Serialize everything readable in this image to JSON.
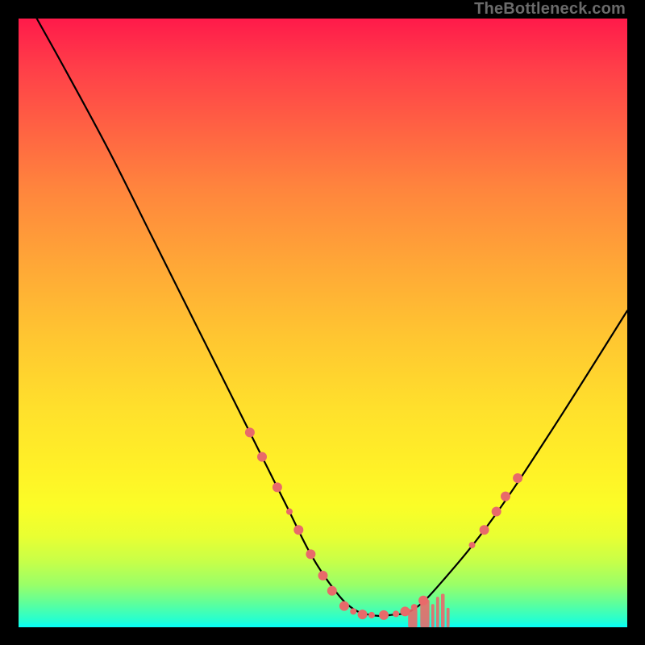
{
  "watermark": "TheBottleneck.com",
  "chart_data": {
    "type": "line",
    "title": "",
    "xlabel": "",
    "ylabel": "",
    "xlim": [
      0,
      100
    ],
    "ylim": [
      0,
      100
    ],
    "grid": false,
    "series": [
      {
        "name": "bottleneck-curve",
        "x": [
          3,
          8,
          15,
          22,
          30,
          38,
          44,
          48,
          52,
          55,
          58,
          61,
          65,
          70,
          78,
          88,
          100
        ],
        "y": [
          100,
          91,
          78,
          64,
          48,
          32,
          20,
          12,
          6,
          3,
          2,
          2,
          3,
          8,
          18,
          33,
          52
        ],
        "color": "#000000"
      }
    ],
    "markers": {
      "name": "highlight-points",
      "color": "#e86a6a",
      "radius_large": 6.0,
      "radius_small": 4.0,
      "points": [
        {
          "x": 38.0,
          "y": 32.0,
          "r": "large"
        },
        {
          "x": 40.0,
          "y": 28.0,
          "r": "large"
        },
        {
          "x": 42.5,
          "y": 23.0,
          "r": "large"
        },
        {
          "x": 44.5,
          "y": 19.0,
          "r": "small"
        },
        {
          "x": 46.0,
          "y": 16.0,
          "r": "large"
        },
        {
          "x": 48.0,
          "y": 12.0,
          "r": "large"
        },
        {
          "x": 50.0,
          "y": 8.5,
          "r": "large"
        },
        {
          "x": 51.5,
          "y": 6.0,
          "r": "large"
        },
        {
          "x": 53.5,
          "y": 3.5,
          "r": "large"
        },
        {
          "x": 55.0,
          "y": 2.6,
          "r": "small"
        },
        {
          "x": 56.5,
          "y": 2.1,
          "r": "large"
        },
        {
          "x": 58.0,
          "y": 2.0,
          "r": "small"
        },
        {
          "x": 60.0,
          "y": 2.0,
          "r": "large"
        },
        {
          "x": 62.0,
          "y": 2.2,
          "r": "small"
        },
        {
          "x": 63.5,
          "y": 2.6,
          "r": "large"
        },
        {
          "x": 65.0,
          "y": 3.3,
          "r": "small"
        },
        {
          "x": 66.5,
          "y": 4.4,
          "r": "large"
        },
        {
          "x": 74.5,
          "y": 13.5,
          "r": "small"
        },
        {
          "x": 76.5,
          "y": 16.0,
          "r": "large"
        },
        {
          "x": 78.5,
          "y": 19.0,
          "r": "large"
        },
        {
          "x": 80.0,
          "y": 21.5,
          "r": "large"
        },
        {
          "x": 82.0,
          "y": 24.5,
          "r": "large"
        }
      ]
    },
    "bottom_streaks": {
      "color": "#e86a6a",
      "segments": [
        {
          "x0": 64.0,
          "x1": 65.5,
          "y0": 0.0,
          "y1": 3.0
        },
        {
          "x0": 66.0,
          "x1": 67.5,
          "y0": 0.0,
          "y1": 4.5
        },
        {
          "x0": 67.8,
          "x1": 68.3,
          "y0": 0.0,
          "y1": 3.8
        },
        {
          "x0": 68.6,
          "x1": 69.1,
          "y0": 0.0,
          "y1": 5.0
        },
        {
          "x0": 69.4,
          "x1": 70.0,
          "y0": 0.0,
          "y1": 5.5
        },
        {
          "x0": 70.3,
          "x1": 70.8,
          "y0": 0.0,
          "y1": 3.2
        }
      ]
    }
  }
}
